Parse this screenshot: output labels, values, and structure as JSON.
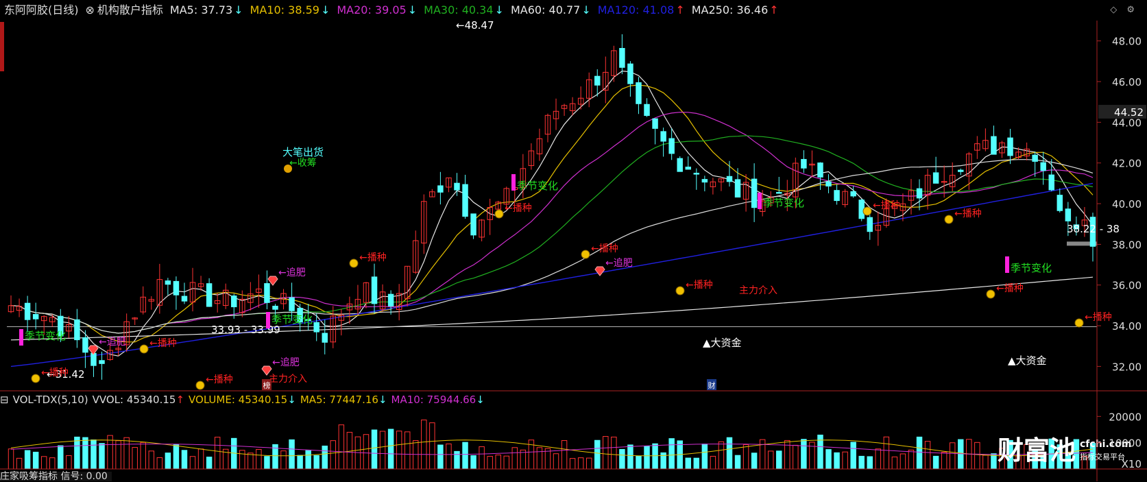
{
  "header": {
    "stock_name": "东阿阿胶(日线)",
    "indicator_name": "机构散户指标",
    "ma": [
      {
        "label": "MA5: 37.73",
        "arrow": "↓",
        "color": "#e8e8e8"
      },
      {
        "label": "MA10: 38.59",
        "arrow": "↓",
        "color": "#e6c000"
      },
      {
        "label": "MA20: 39.05",
        "arrow": "↓",
        "color": "#d030d0"
      },
      {
        "label": "MA30: 40.34",
        "arrow": "↓",
        "color": "#20b020"
      },
      {
        "label": "MA60: 40.77",
        "arrow": "↓",
        "color": "#e8e8e8"
      },
      {
        "label": "MA120: 41.08",
        "arrow": "↑",
        "color": "#2020e0"
      },
      {
        "label": "MA250: 36.46",
        "arrow": "↑",
        "color": "#e8e8e8"
      }
    ]
  },
  "price_axis": {
    "ticks": [
      "48.00",
      "46.00",
      "44.00",
      "42.00",
      "40.00",
      "38.00",
      "36.00",
      "34.00",
      "32.00"
    ],
    "current_price": "44.52",
    "last_range": "38.22 - 38"
  },
  "volume_header": {
    "name": "VOL-TDX(5,10)",
    "vvol": "VVOL: 45340.15",
    "vvol_arrow": "↑",
    "volume": "VOLUME: 45340.15",
    "volume_arrow": "↓",
    "ma5": "MA5: 77447.16",
    "ma5_arrow": "↓",
    "ma10": "MA10: 75944.66",
    "ma10_arrow": "↓"
  },
  "volume_axis": {
    "ticks": [
      "20000",
      "10000"
    ],
    "unit": "X10"
  },
  "bottom_indicator": "庄家吸筹指标  信号: 0.00",
  "annotations": {
    "high_label": "48.47",
    "low_label": "31.42",
    "range_label": "33.93 - 33.99",
    "big_sell": "大笔出货",
    "shou_chou": "收筹",
    "season_change": "季节变化",
    "sow": "播种",
    "fertilize": "追肥",
    "main_force": "主力介入",
    "big_funds": "大资金",
    "cai": "财",
    "bang": "榜"
  },
  "logo": {
    "brand": "财富池",
    "domain": "cfchi.com",
    "tagline": "指标交易平台"
  },
  "colors": {
    "up_candle": "#ff3333",
    "down_candle": "#54ffff",
    "ma5": "#e8e8e8",
    "ma10": "#e6c000",
    "ma20": "#d030d0",
    "ma30": "#20b020",
    "ma60": "#dddddd",
    "ma120": "#2020e0",
    "ma250": "#e8e8e8"
  }
}
